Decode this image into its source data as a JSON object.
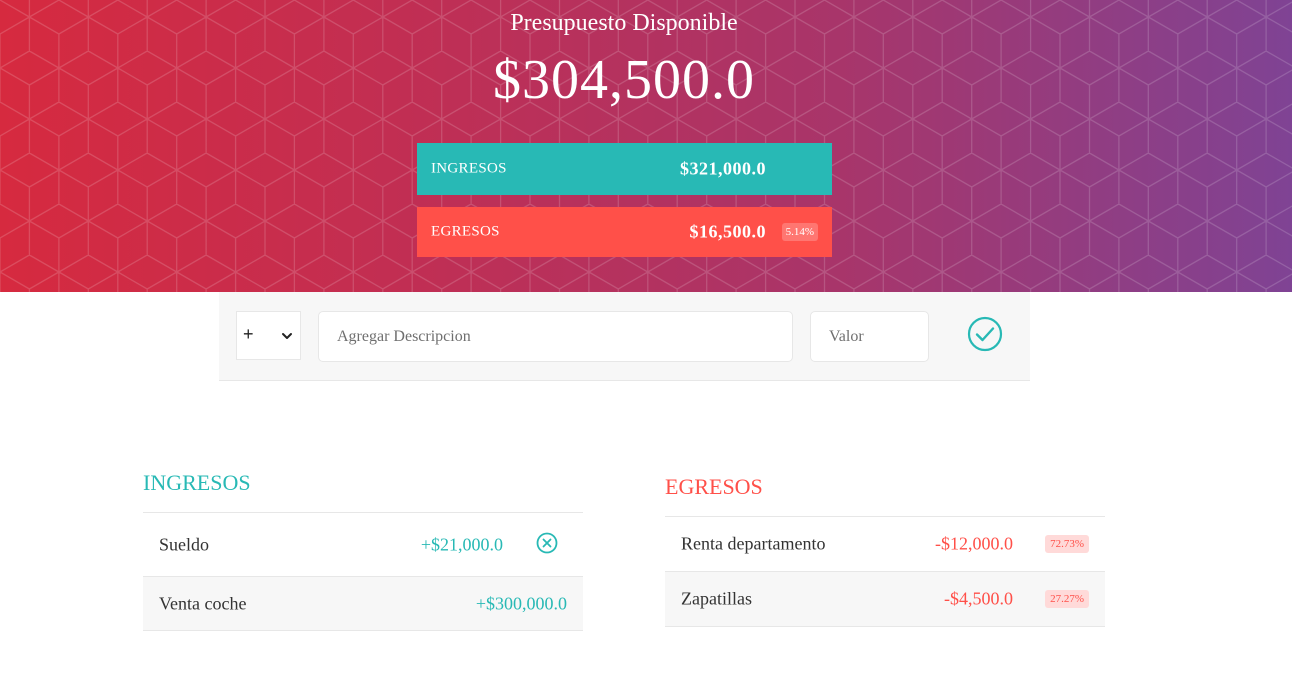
{
  "header": {
    "title": "Presupuesto Disponible",
    "budget": "$304,500.0",
    "income": {
      "label": "INGRESOS",
      "value": "$321,000.0"
    },
    "expense": {
      "label": "EGRESOS",
      "value": "$16,500.0",
      "percentage": "5.14%"
    }
  },
  "add_bar": {
    "type_value": "+",
    "description_placeholder": "Agregar Descripcion",
    "value_placeholder": "Valor",
    "submit_icon": "check-circle-icon"
  },
  "income_list": {
    "title": "INGRESOS",
    "items": [
      {
        "description": "Sueldo",
        "value": "+$21,000.0"
      },
      {
        "description": "Venta coche",
        "value": "+$300,000.0"
      }
    ]
  },
  "expense_list": {
    "title": "EGRESOS",
    "items": [
      {
        "description": "Renta departamento",
        "value": "-$12,000.0",
        "percentage": "72.73%"
      },
      {
        "description": "Zapatillas",
        "value": "-$4,500.0",
        "percentage": "27.27%"
      }
    ]
  },
  "colors": {
    "income": "#28b9b5",
    "expense": "#ff5049",
    "header_start": "#d62a3f",
    "header_end": "#7f4394"
  }
}
